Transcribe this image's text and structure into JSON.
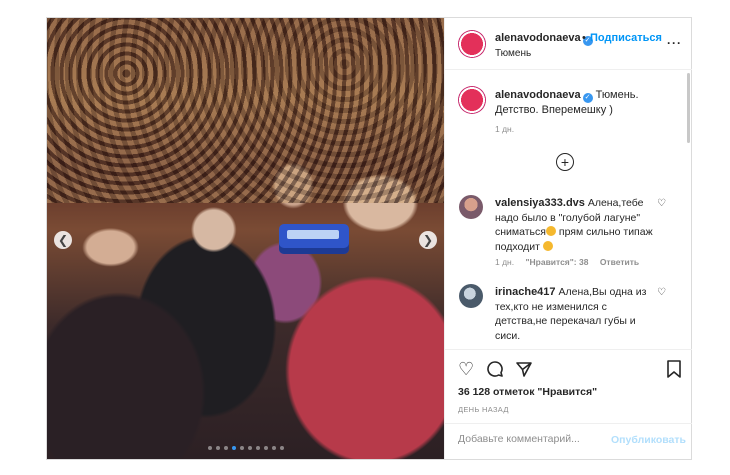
{
  "post": {
    "photo": {
      "alt": "",
      "slides": 10,
      "active_slide": 4
    },
    "header": {
      "username": "alenavodonaeva",
      "verified_mark": "✓",
      "separator": "•",
      "follow_label": "Подписаться",
      "location": "Тюмень",
      "more_label": "···"
    },
    "caption": {
      "username": "alenavodonaeva",
      "text": "Тюмень. Детство. Вперемешку )",
      "time": "1 дн."
    },
    "load_more_label": "+",
    "comments": [
      {
        "username": "valensiya333.dvs",
        "text_a": "Алена,тебе надо было в \"голубой лагуне\" сниматься",
        "text_b": " прям сильно типаж подходит",
        "time": "1 дн.",
        "likes": "\"Нравится\": 38",
        "reply": "Ответить"
      },
      {
        "username": "irinache417",
        "text": "Алена,Вы одна из тех,кто не изменился с детства,не перекачал губы и сиси."
      }
    ],
    "actions": {
      "likes_count": "36 128 отметок \"Нравится\"",
      "posted": "ДЕНЬ НАЗАД"
    },
    "add_comment": {
      "placeholder": "Добавьте комментарий...",
      "publish_label": "Опубликовать"
    },
    "colors": {
      "accent": "#0095f6",
      "publish_disabled": "#b2dffc",
      "dot_active": "#3897f0",
      "muted": "#8e8e8e"
    }
  }
}
